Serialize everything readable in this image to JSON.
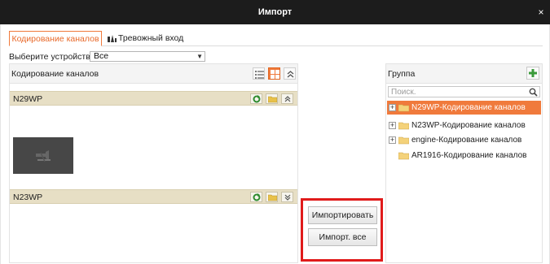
{
  "window": {
    "title": "Импорт",
    "close_glyph": "×"
  },
  "tabs": [
    {
      "label": "Кодирование каналов",
      "active": true
    },
    {
      "label": "Тревожный вход",
      "active": false,
      "icon": "alarm-input-icon"
    }
  ],
  "device_select": {
    "label": "Выберите устройство",
    "value": "Все"
  },
  "left_panel": {
    "header": "Кодирование каналов",
    "devices": [
      {
        "name": "N29WP",
        "expanded": true
      },
      {
        "name": "N23WP",
        "expanded": false
      }
    ]
  },
  "actions": {
    "import_label": "Импортировать",
    "import_all_label": "Импорт. все"
  },
  "right_panel": {
    "header": "Группа",
    "search_placeholder": "Поиск.",
    "groups": [
      {
        "label": "N29WP-Кодирование каналов",
        "selected": true,
        "expandable": true
      },
      {
        "label": "N23WP-Кодирование каналов",
        "selected": false,
        "expandable": true
      },
      {
        "label": "engine-Кодирование каналов",
        "selected": false,
        "expandable": true
      },
      {
        "label": "AR1916-Кодирование каналов",
        "selected": false,
        "expandable": false
      }
    ]
  },
  "colors": {
    "accent": "#f07a3c",
    "highlight_frame": "#e01b1b",
    "titlebar": "#1c1c1c",
    "device_row": "#e7dfc5"
  }
}
